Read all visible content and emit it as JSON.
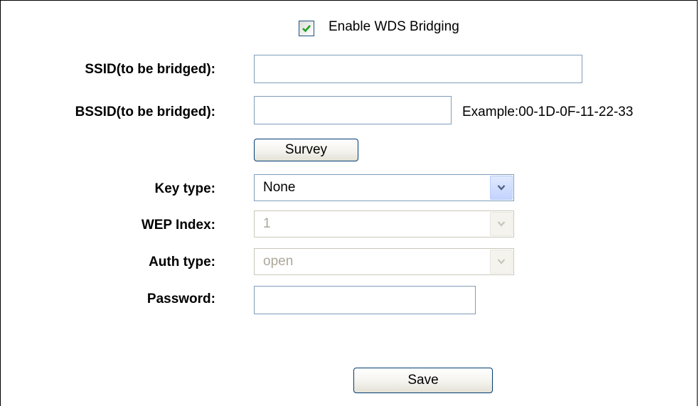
{
  "wds": {
    "enable_label": "Enable WDS Bridging",
    "enabled": true
  },
  "fields": {
    "ssid": {
      "label": "SSID(to be bridged):",
      "value": ""
    },
    "bssid": {
      "label": "BSSID(to be bridged):",
      "value": "",
      "example": "Example:00-1D-0F-11-22-33"
    },
    "key_type": {
      "label": "Key type:",
      "selected": "None"
    },
    "wep_index": {
      "label": "WEP Index:",
      "selected": "1",
      "disabled": true
    },
    "auth_type": {
      "label": "Auth type:",
      "selected": "open",
      "disabled": true
    },
    "password": {
      "label": "Password:",
      "value": ""
    }
  },
  "buttons": {
    "survey": "Survey",
    "save": "Save"
  },
  "icons": {
    "checkbox_check": "check-icon",
    "dropdown": "chevron-down-icon"
  },
  "colors": {
    "check": "#21a121",
    "dropdown_arrow": "#4d6185",
    "disabled_text": "#aca899"
  }
}
